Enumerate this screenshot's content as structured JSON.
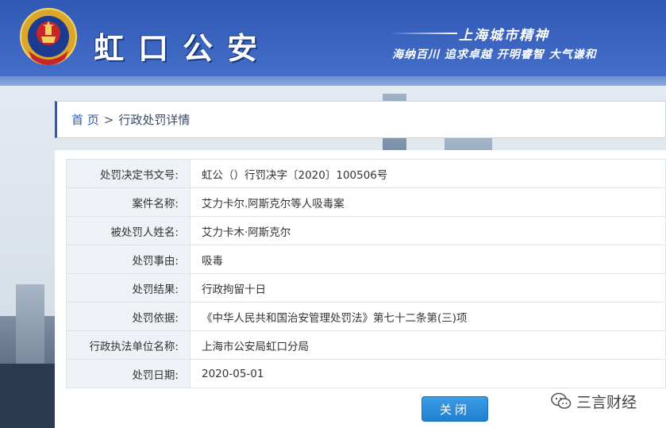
{
  "header": {
    "title": "虹口公安",
    "slogan_line1": "上海城市精神",
    "slogan_line2": "海纳百川 追求卓越 开明睿智 大气谦和"
  },
  "breadcrumb": {
    "home": "首 页",
    "separator": ">",
    "current": "行政处罚详情"
  },
  "details": {
    "rows": [
      {
        "label": "处罚决定书文号:",
        "value": "虹公（）行罚决字〔2020〕100506号"
      },
      {
        "label": "案件名称:",
        "value": "艾力卡尔.阿斯克尔等人吸毒案"
      },
      {
        "label": "被处罚人姓名:",
        "value": "艾力卡木·阿斯克尔"
      },
      {
        "label": "处罚事由:",
        "value": "吸毒"
      },
      {
        "label": "处罚结果:",
        "value": "行政拘留十日"
      },
      {
        "label": "处罚依据:",
        "value": "《中华人民共和国治安管理处罚法》第七十二条第(三)项"
      },
      {
        "label": "行政执法单位名称:",
        "value": "上海市公安局虹口分局"
      },
      {
        "label": "处罚日期:",
        "value": "2020-05-01"
      }
    ]
  },
  "buttons": {
    "close_label": "关闭"
  },
  "watermark": {
    "text": "三言财经"
  },
  "colors": {
    "header_blue": "#2f59b4",
    "button_blue": "#1f7fd0",
    "label_bg": "#eef1f5"
  }
}
